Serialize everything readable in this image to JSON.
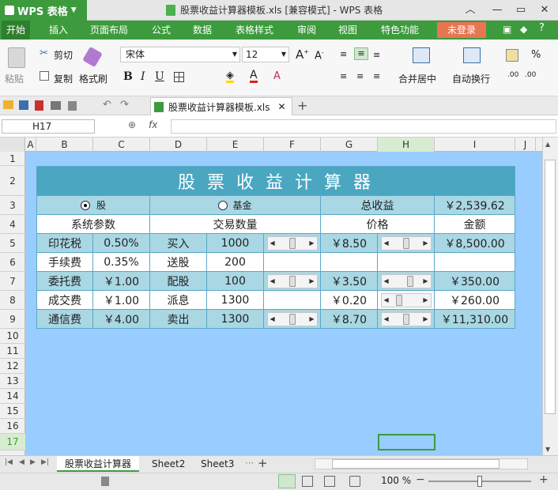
{
  "app": {
    "name": "WPS 表格",
    "window_title": "股票收益计算器模板.xls [兼容模式] - WPS 表格"
  },
  "menu": [
    "开始",
    "插入",
    "页面布局",
    "公式",
    "数据",
    "表格样式",
    "审阅",
    "视图",
    "特色功能"
  ],
  "login_label": "未登录",
  "ribbon": {
    "paste": "粘贴",
    "cut": "剪切",
    "copy": "复制",
    "format_painter": "格式刷",
    "font_name": "宋体",
    "font_size": "12",
    "bold": "B",
    "italic": "I",
    "underline": "U",
    "merge_center": "合并居中",
    "wrap_text": "自动换行",
    "percent": "%",
    "inc_decimal": ".00",
    "dec_decimal": ".00"
  },
  "document_tab": "股票收益计算器模板.xls",
  "name_box": "H17",
  "fx": "fx",
  "columns": [
    "A",
    "B",
    "C",
    "D",
    "E",
    "F",
    "G",
    "H",
    "I",
    "J"
  ],
  "rows": [
    "1",
    "2",
    "3",
    "4",
    "5",
    "6",
    "7",
    "8",
    "9",
    "10",
    "11",
    "12",
    "13",
    "14",
    "15",
    "16",
    "17"
  ],
  "sheet": {
    "title": "股 票 收 益 计 算 器",
    "radio_stock": "股",
    "radio_fund": "基金",
    "total_label": "总收益",
    "total_value": "￥2,539.62",
    "hdr_params": "系统参数",
    "hdr_qty": "交易数量",
    "hdr_price": "价格",
    "hdr_amount": "金额",
    "param_names": [
      "印花税",
      "手续费",
      "委托费",
      "成交费",
      "通信费"
    ],
    "param_values": [
      "0.50%",
      "0.35%",
      "￥1.00",
      "￥1.00",
      "￥4.00"
    ],
    "trade_types": [
      "买入",
      "送股",
      "配股",
      "派息",
      "卖出"
    ],
    "quantities": [
      "1000",
      "200",
      "100",
      "1300",
      "1300"
    ],
    "prices": [
      "￥8.50",
      "",
      "￥3.50",
      "￥0.20",
      "￥8.70"
    ],
    "amounts": [
      "￥8,500.00",
      "",
      "￥350.00",
      "￥260.00",
      "￥11,310.00"
    ]
  },
  "sheet_tabs": [
    "股票收益计算器",
    "Sheet2",
    "Sheet3"
  ],
  "zoom": "100 %",
  "colors": {
    "brand_green": "#3d9b3d",
    "sheet_bg": "#99ccff",
    "table_header": "#4aa6c1",
    "band": "#a9d7e4",
    "login": "#e87552"
  }
}
